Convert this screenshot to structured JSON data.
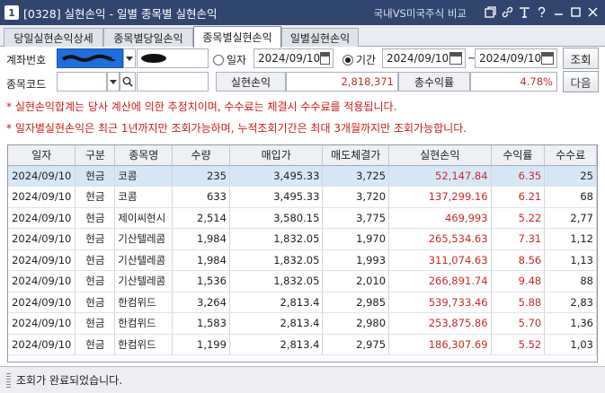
{
  "window": {
    "badge": "1",
    "title": "[0328] 실현손익 - 일별 종목별 실현손익",
    "title_link": "국내VS미국주식 비교",
    "icons": [
      "restore-icon",
      "link-icon",
      "text-icon",
      "help-icon",
      "minimize-icon",
      "maximize-icon",
      "close-icon"
    ]
  },
  "tabs": [
    {
      "label": "당일실현손익상세",
      "active": false
    },
    {
      "label": "종목별당일손익",
      "active": false
    },
    {
      "label": "종목별실현손익",
      "active": true
    },
    {
      "label": "일별실현손익",
      "active": false
    }
  ],
  "form": {
    "account_label": "계좌번호",
    "date_radio_label": "일자",
    "period_radio_label": "기간",
    "single_date": "2024/09/10",
    "start_date": "2024/09/10",
    "tilde": "~",
    "end_date": "2024/09/10",
    "query_button": "조회",
    "stock_code_label": "종목코드",
    "next_button": "다음",
    "realized_pl_label": "실현손익",
    "realized_pl_value": "2,818,371",
    "total_return_label": "총수익률",
    "total_return_value": "4.78%"
  },
  "notes": [
    "* 실현손익합계는 당사 계산에 의한 추정치이며, 수수료는 체결시 수수료를 적용됩니다.",
    "* 일자별실현손익은 최근 1년까지만 조회가능하며, 누적조회기간은 최대 3개월까지만 조회가능합니다."
  ],
  "table": {
    "headers": [
      "일자",
      "구분",
      "종목명",
      "수량",
      "매입가",
      "매도체결가",
      "실현손익",
      "수익률",
      "수수료"
    ],
    "rows": [
      [
        "2024/09/10",
        "현금",
        "코콤",
        "235",
        "3,495.33",
        "3,725",
        "52,147.84",
        "6.35",
        "25"
      ],
      [
        "2024/09/10",
        "현금",
        "코콤",
        "633",
        "3,495.33",
        "3,720",
        "137,299.16",
        "6.21",
        "68"
      ],
      [
        "2024/09/10",
        "현금",
        "제이씨현시",
        "2,514",
        "3,580.15",
        "3,775",
        "469,993",
        "5.22",
        "2,77"
      ],
      [
        "2024/09/10",
        "현금",
        "기산텔레콤",
        "1,984",
        "1,832.05",
        "1,970",
        "265,534.63",
        "7.31",
        "1,12"
      ],
      [
        "2024/09/10",
        "현금",
        "기산텔레콤",
        "1,984",
        "1,832.05",
        "1,993",
        "311,074.63",
        "8.56",
        "1,13"
      ],
      [
        "2024/09/10",
        "현금",
        "기산텔레콤",
        "1,536",
        "1,832.05",
        "2,010",
        "266,891.74",
        "9.48",
        "88"
      ],
      [
        "2024/09/10",
        "현금",
        "한컴위드",
        "3,264",
        "2,813.4",
        "2,985",
        "539,733.46",
        "5.88",
        "2,83"
      ],
      [
        "2024/09/10",
        "현금",
        "한컴위드",
        "1,583",
        "2,813.4",
        "2,980",
        "253,875.86",
        "5.70",
        "1,36"
      ],
      [
        "2024/09/10",
        "현금",
        "한컴위드",
        "1,199",
        "2,813.4",
        "2,975",
        "186,307.69",
        "5.52",
        "1,03"
      ]
    ],
    "selected_row": 0
  },
  "status": {
    "text": "조회가 완료되었습니다."
  }
}
